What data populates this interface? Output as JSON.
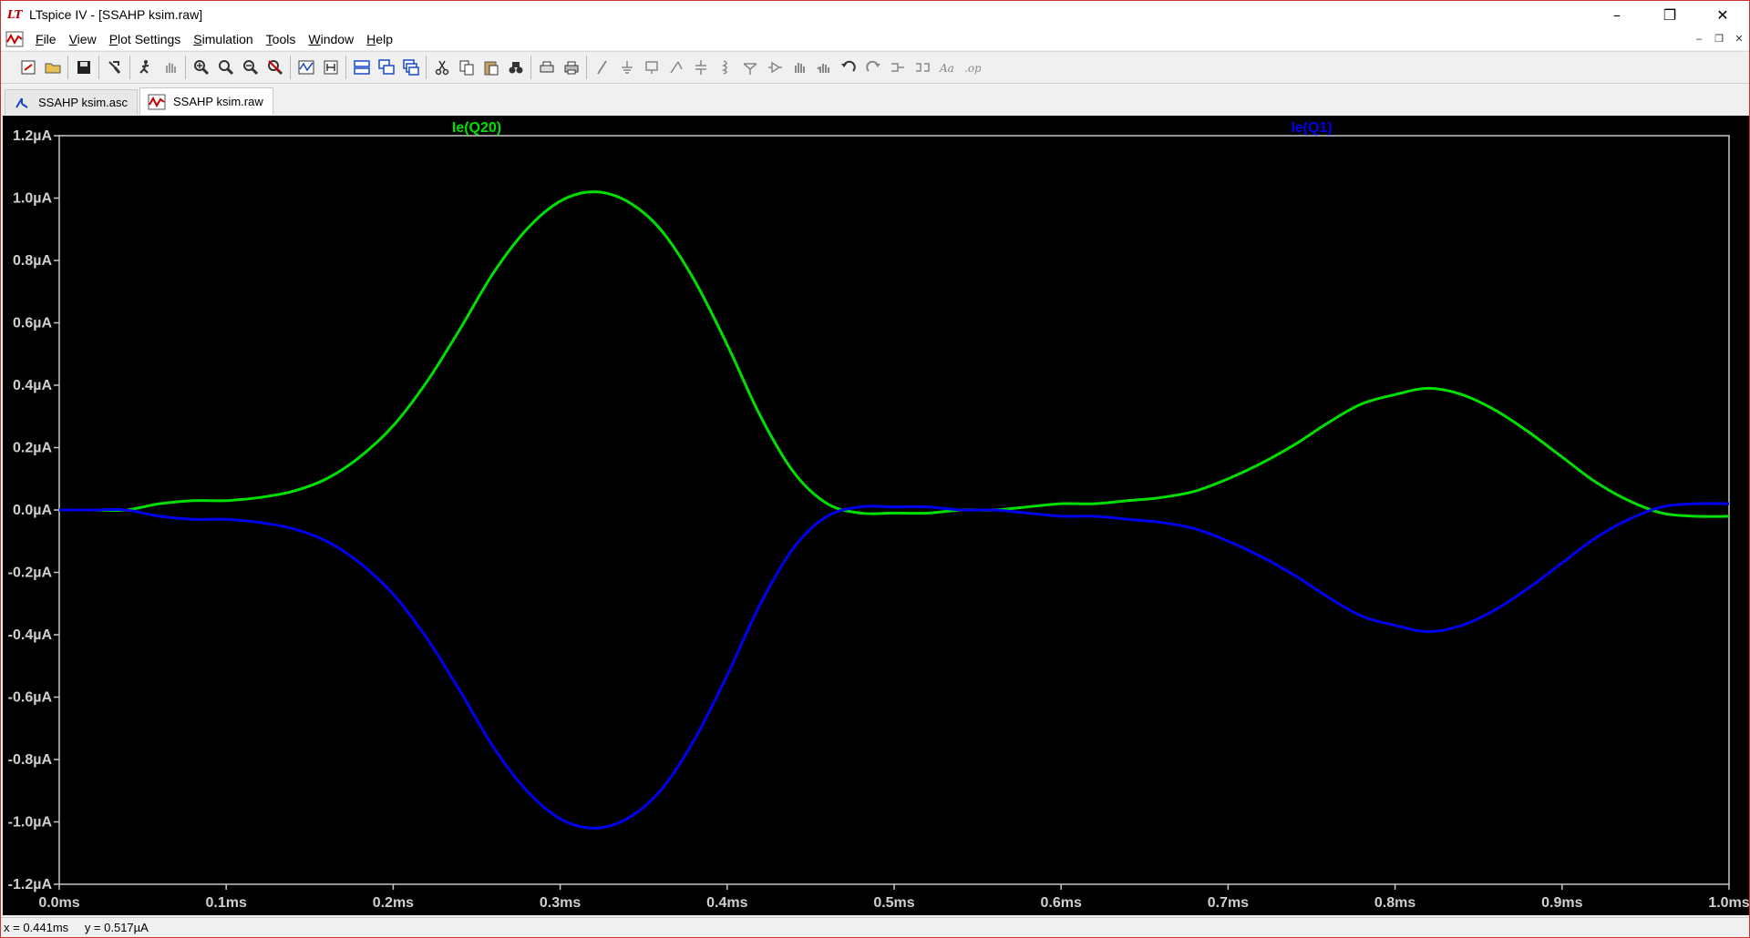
{
  "window": {
    "title": "LTspice IV - [SSAHP ksim.raw]",
    "logo": "LT",
    "minimize": "–",
    "maximize": "❐",
    "close": "✕"
  },
  "menu": [
    {
      "u": "F",
      "rest": "ile"
    },
    {
      "u": "V",
      "rest": "iew"
    },
    {
      "u": "P",
      "rest": "lot Settings"
    },
    {
      "u": "S",
      "rest": "imulation"
    },
    {
      "u": "T",
      "rest": "ools"
    },
    {
      "u": "W",
      "rest": "indow"
    },
    {
      "u": "H",
      "rest": "elp"
    }
  ],
  "mdi": {
    "minimize": "–",
    "restore": "❐",
    "close": "✕"
  },
  "toolbar": [
    "new-schematic-icon",
    "open-icon",
    "sep",
    "save-icon",
    "sep",
    "control-panel-icon",
    "sep",
    "run-icon",
    "pan-icon",
    "sep",
    "zoom-in-icon",
    "zoom-fit-icon",
    "zoom-out-icon",
    "zoom-cancel-icon",
    "sep",
    "autorange-icon",
    "mark-icon",
    "sep",
    "tile-horizontal-icon",
    "cascade-icon",
    "tile-vertical-icon",
    "sep",
    "cut-icon",
    "copy-icon",
    "paste-icon",
    "find-icon",
    "sep",
    "print-setup-icon",
    "print-icon",
    "sep",
    "wire-icon",
    "ground-icon",
    "label-icon",
    "diode-icon",
    "capacitor-icon",
    "inductor-icon",
    "resistor-icon",
    "component-icon",
    "move-icon",
    "drag-icon",
    "undo-icon",
    "redo-icon",
    "rotate-icon",
    "mirror-icon",
    "text-icon",
    "spice-directive-icon"
  ],
  "tabs": [
    {
      "label": "SSAHP ksim.asc",
      "icon": "schematic-icon",
      "active": false
    },
    {
      "label": "SSAHP ksim.raw",
      "icon": "waveform-icon",
      "active": true
    }
  ],
  "chart_data": {
    "type": "line",
    "xlabel": "",
    "ylabel": "",
    "xlim": [
      0.0,
      1.0
    ],
    "ylim": [
      -1.2,
      1.2
    ],
    "x_ticks": [
      0.0,
      0.1,
      0.2,
      0.3,
      0.4,
      0.5,
      0.6,
      0.7,
      0.8,
      0.9,
      1.0
    ],
    "x_tick_labels": [
      "0.0ms",
      "0.1ms",
      "0.2ms",
      "0.3ms",
      "0.4ms",
      "0.5ms",
      "0.6ms",
      "0.7ms",
      "0.8ms",
      "0.9ms",
      "1.0ms"
    ],
    "y_ticks": [
      1.2,
      1.0,
      0.8,
      0.6,
      0.4,
      0.2,
      0.0,
      -0.2,
      -0.4,
      -0.6,
      -0.8,
      -1.0,
      -1.2
    ],
    "y_tick_labels": [
      "1.2µA",
      "1.0µA",
      "0.8µA",
      "0.6µA",
      "0.4µA",
      "0.2µA",
      "0.0µA",
      "-0.2µA",
      "-0.4µA",
      "-0.6µA",
      "-0.8µA",
      "-1.0µA",
      "-1.2µA"
    ],
    "grid": false,
    "background": "#000000",
    "axis_color": "#c8c8c8",
    "x": [
      0.0,
      0.02,
      0.04,
      0.06,
      0.08,
      0.1,
      0.12,
      0.14,
      0.16,
      0.18,
      0.2,
      0.22,
      0.24,
      0.26,
      0.28,
      0.3,
      0.32,
      0.34,
      0.36,
      0.38,
      0.4,
      0.42,
      0.44,
      0.46,
      0.48,
      0.5,
      0.52,
      0.54,
      0.56,
      0.58,
      0.6,
      0.62,
      0.64,
      0.66,
      0.68,
      0.7,
      0.72,
      0.74,
      0.76,
      0.78,
      0.8,
      0.82,
      0.84,
      0.86,
      0.88,
      0.9,
      0.92,
      0.94,
      0.96,
      0.98,
      1.0
    ],
    "series": [
      {
        "name": "Ie(Q20)",
        "color": "#00e000",
        "values": [
          0.0,
          0.0,
          0.0,
          0.02,
          0.03,
          0.03,
          0.04,
          0.06,
          0.1,
          0.17,
          0.27,
          0.41,
          0.58,
          0.76,
          0.9,
          0.99,
          1.02,
          0.99,
          0.9,
          0.74,
          0.53,
          0.3,
          0.12,
          0.02,
          -0.01,
          -0.01,
          -0.01,
          0.0,
          0.0,
          0.01,
          0.02,
          0.02,
          0.03,
          0.04,
          0.06,
          0.1,
          0.15,
          0.21,
          0.28,
          0.34,
          0.37,
          0.39,
          0.37,
          0.32,
          0.25,
          0.17,
          0.09,
          0.03,
          -0.01,
          -0.02,
          -0.02
        ]
      },
      {
        "name": "Ie(Q1)",
        "color": "#0000f0",
        "values": [
          0.0,
          0.0,
          0.0,
          -0.02,
          -0.03,
          -0.03,
          -0.04,
          -0.06,
          -0.1,
          -0.17,
          -0.27,
          -0.41,
          -0.58,
          -0.76,
          -0.9,
          -0.99,
          -1.02,
          -0.99,
          -0.9,
          -0.74,
          -0.53,
          -0.3,
          -0.12,
          -0.02,
          0.01,
          0.01,
          0.01,
          0.0,
          0.0,
          -0.01,
          -0.02,
          -0.02,
          -0.03,
          -0.04,
          -0.06,
          -0.1,
          -0.15,
          -0.21,
          -0.28,
          -0.34,
          -0.37,
          -0.39,
          -0.37,
          -0.32,
          -0.25,
          -0.17,
          -0.09,
          -0.03,
          0.01,
          0.02,
          0.02
        ]
      }
    ]
  },
  "status": {
    "x": "x = 0.441ms",
    "y": "y = 0.517µA"
  }
}
